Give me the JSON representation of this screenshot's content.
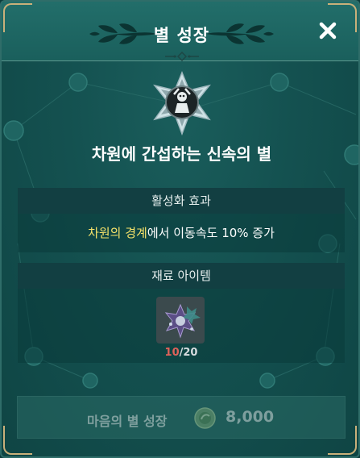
{
  "dialog": {
    "title": "별 성장",
    "close_icon": "close-icon"
  },
  "star": {
    "icon": "star-emblem-icon",
    "name": "차원에 간섭하는 신속의 별"
  },
  "effect_section": {
    "header": "활성화 효과",
    "highlight": "차원의 경계",
    "text": "에서 이동속도 10% 증가"
  },
  "material_section": {
    "header": "재료 아이템",
    "item_icon": "star-fragment-icon",
    "count_current": "10",
    "count_total": "/20"
  },
  "grow_button": {
    "label": "마음의 별 성장",
    "coin_icon": "coin-icon",
    "cost": "8,000",
    "enabled": false
  },
  "colors": {
    "highlight_text": "#f7e36a",
    "count_shortage": "#e0625a",
    "panel_teal": "#145150"
  }
}
